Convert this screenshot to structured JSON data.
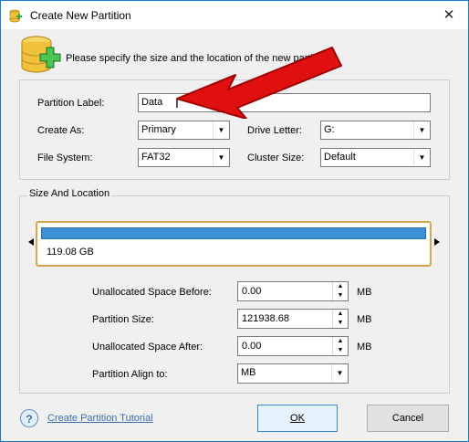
{
  "window": {
    "title": "Create New Partition",
    "close_glyph": "✕"
  },
  "header": {
    "text": "Please specify the size and the location of the new partition.",
    "icon": "database-plus-icon"
  },
  "form": {
    "partition_label": {
      "label": "Partition Label:",
      "value": "Data"
    },
    "create_as": {
      "label": "Create As:",
      "value": "Primary"
    },
    "drive_letter": {
      "label": "Drive Letter:",
      "value": "G:"
    },
    "file_system": {
      "label": "File System:",
      "value": "FAT32"
    },
    "cluster_size": {
      "label": "Cluster Size:",
      "value": "Default"
    }
  },
  "size_location": {
    "title": "Size And Location",
    "disk_size": "119.08 GB",
    "unallocated_before": {
      "label": "Unallocated Space Before:",
      "value": "0.00",
      "unit": "MB"
    },
    "partition_size": {
      "label": "Partition Size:",
      "value": "121938.68",
      "unit": "MB"
    },
    "unallocated_after": {
      "label": "Unallocated Space After:",
      "value": "0.00",
      "unit": "MB"
    },
    "align": {
      "label": "Partition Align to:",
      "value": "MB"
    }
  },
  "footer": {
    "tutorial_link": "Create Partition Tutorial",
    "ok_label": "OK",
    "cancel_label": "Cancel"
  },
  "colors": {
    "accent_border": "#1979ca",
    "disk_bar": "#3d8fd6",
    "disk_frame": "#d4a74a",
    "annotation_arrow": "#e01010",
    "link": "#3a6fb0"
  }
}
